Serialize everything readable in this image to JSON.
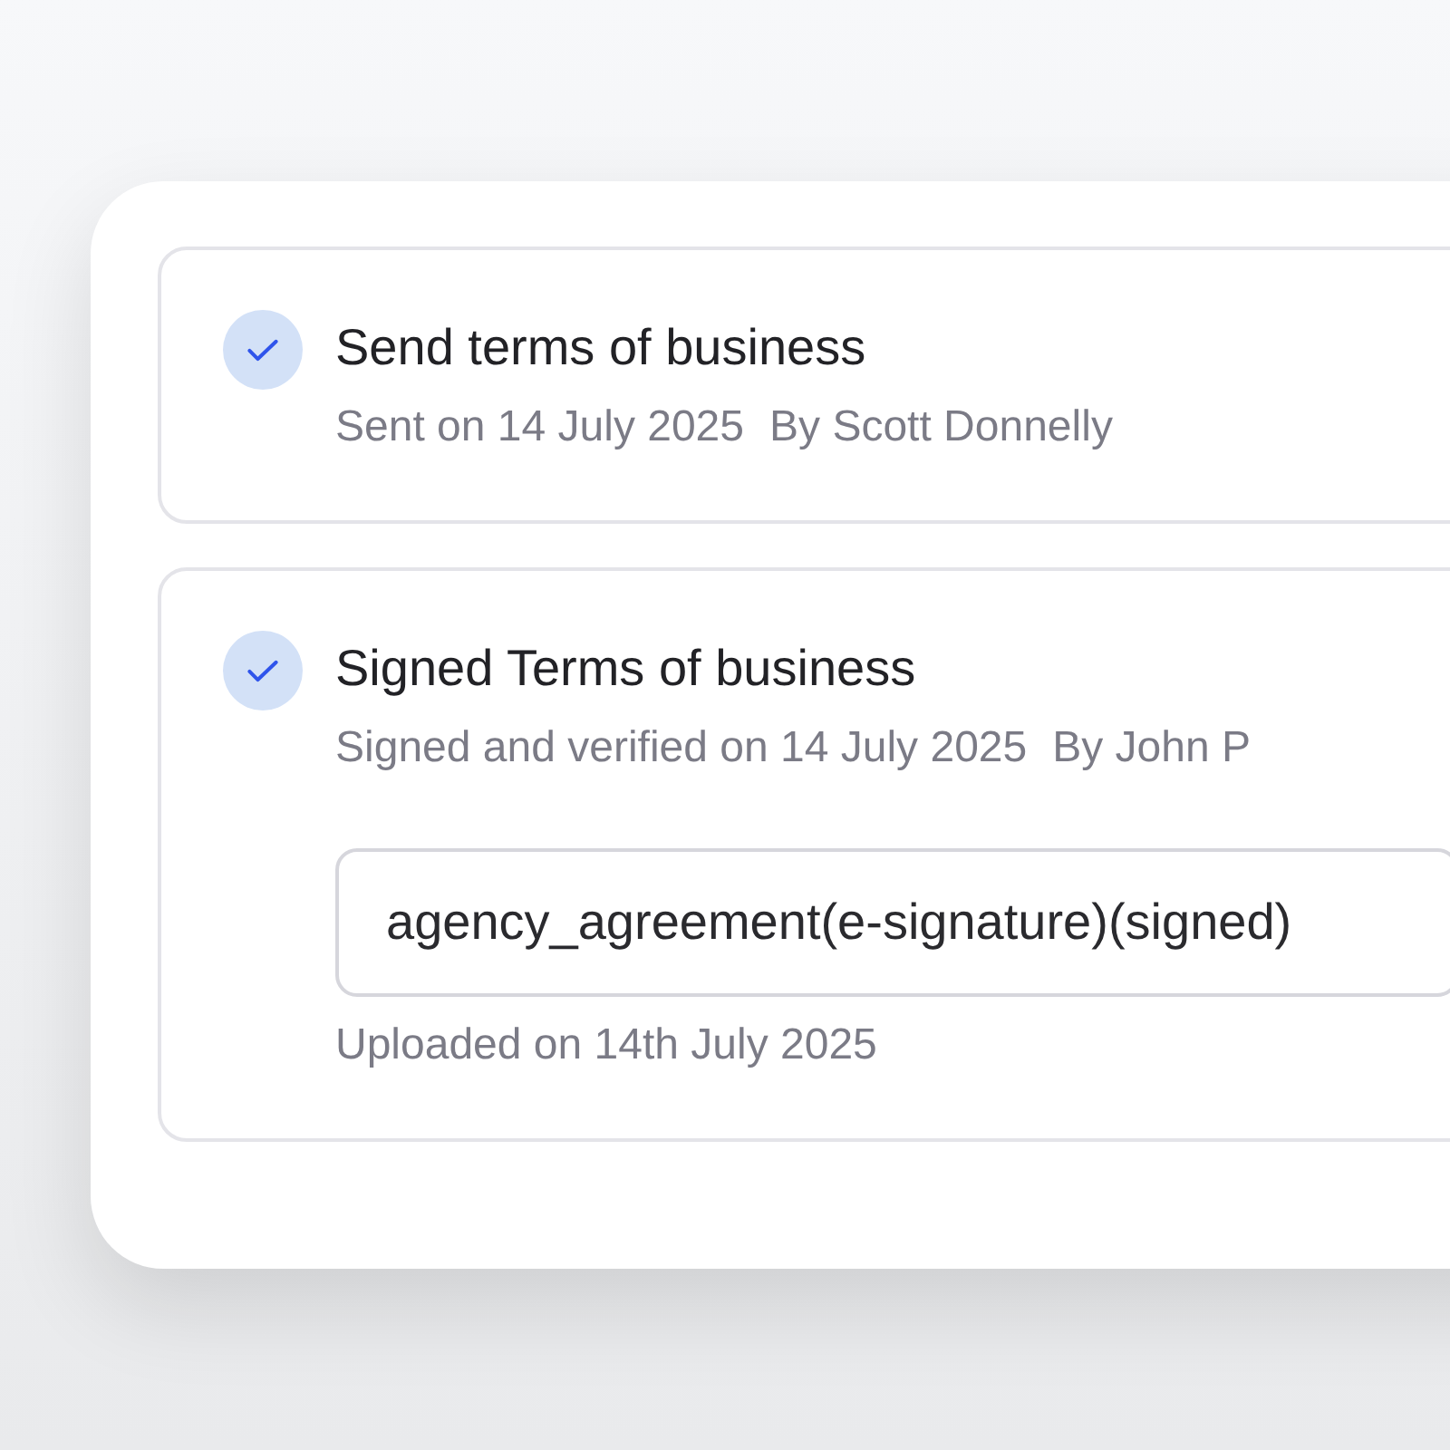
{
  "steps": [
    {
      "title": "Send terms of business",
      "done": true,
      "details": [
        "Sent on 14 July 2025",
        "By Scott Donnelly"
      ]
    },
    {
      "title": "Signed Terms of business",
      "done": true,
      "details": [
        "Signed and verified on 14 July 2025",
        "By John P"
      ],
      "file": {
        "value": "agency_agreement(e-signature)(signed)",
        "note": "Uploaded on 14th July 2025"
      }
    }
  ]
}
